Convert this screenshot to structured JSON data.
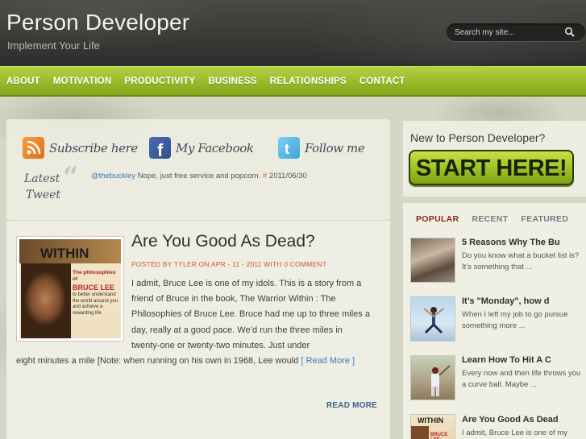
{
  "header": {
    "title": "Person Developer",
    "tagline": "Implement Your Life",
    "search_placeholder": "Search my site...",
    "search_icon": "magnifier-icon"
  },
  "nav": {
    "items": [
      "ABOUT",
      "MOTIVATION",
      "PRODUCTIVITY",
      "BUSINESS",
      "RELATIONSHIPS",
      "CONTACT"
    ]
  },
  "social": {
    "subscribe": "Subscribe here",
    "facebook": "My Facebook",
    "twitter": "Follow me",
    "latest_tweet_label_1": "Latest",
    "latest_tweet_label_2": "Tweet"
  },
  "tweet": {
    "user": "@thebuckley",
    "text": " Nope, just free service and popcorn. ",
    "hash": "#",
    "date": " 2011/06/30"
  },
  "post": {
    "title": "Are You Good As Dead?",
    "meta": "POSTED BY TYLER ON APR - 11 - 2011 WITH 0 COMMENT",
    "excerpt_indented": "I admit, Bruce Lee is one of my idols. This is a story from a friend of Bruce in the book, The Warrior Within : The Philosophies of Bruce Lee. Bruce had me up to three miles a day, really at a good pace. We’d run the three miles in twenty-one or twenty-two minutes. Just under",
    "excerpt_full": "eight minutes a mile [Note: when running on his own in 1968, Lee would ",
    "read_more_inline": "[ Read More ]",
    "read_more_button": "READ MORE",
    "book": {
      "title": "WITHIN",
      "subtitle": "The philosophies of",
      "name": "BRUCE LEE",
      "desc": "to better understand the world around you and achieve a rewarding life"
    }
  },
  "sidebar": {
    "new_to": "New to Person Developer?",
    "start_here": "START HERE!",
    "tabs": [
      "POPULAR",
      "RECENT",
      "FEATURED"
    ],
    "items": [
      {
        "title": "5 Reasons Why The Bu",
        "text": "Do you know what a bucket list is? It’s something that ..."
      },
      {
        "title": "It’s \"Monday\", how d",
        "text": "When I left my job to go pursue something more ..."
      },
      {
        "title": "Learn How To Hit A C",
        "text": "Every now and then life throws you a curve ball. Maybe ..."
      },
      {
        "title": "Are You Good As Dead",
        "text": "I admit, Bruce Lee is one of my"
      }
    ]
  },
  "colors": {
    "nav_green": "#9bbb2b",
    "accent_orange": "#d4562a",
    "link_blue": "#3a7bc0",
    "active_tab": "#8a2a18"
  }
}
